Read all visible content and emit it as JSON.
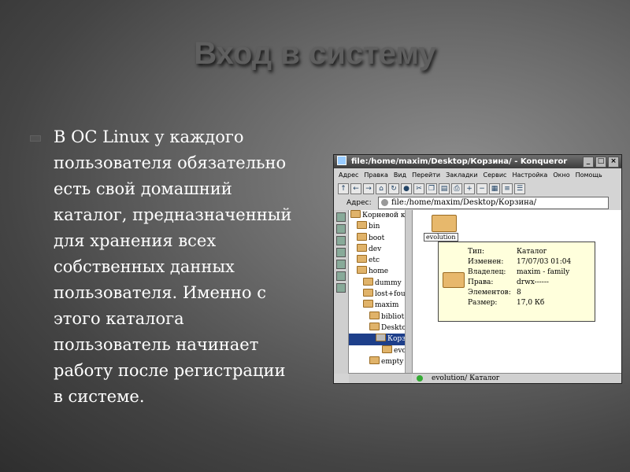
{
  "slide": {
    "title": "Вход в систему",
    "body": "В ОС Linux у каждого\nпользователя обязательно\nесть свой домашний\nкаталог, предназначенный\nдля хранения всех\nсобственных данных\nпользователя. Именно с\nэтого каталога\nпользователь начинает\nработу после регистрации\nв системе."
  },
  "window": {
    "title": "file:/home/maxim/Desktop/Корзина/ - Konqueror",
    "menu": [
      "Адрес",
      "Правка",
      "Вид",
      "Перейти",
      "Закладки",
      "Сервис",
      "Настройка",
      "Окно",
      "Помощь"
    ],
    "address_label": "Адрес:",
    "address": "file:/home/maxim/Desktop/Корзина/",
    "tree": [
      {
        "label": "Корневой каталог",
        "indent": 0
      },
      {
        "label": "bin",
        "indent": 1
      },
      {
        "label": "boot",
        "indent": 1
      },
      {
        "label": "dev",
        "indent": 1
      },
      {
        "label": "etc",
        "indent": 1
      },
      {
        "label": "home",
        "indent": 1
      },
      {
        "label": "dummy",
        "indent": 2
      },
      {
        "label": "lost+found",
        "indent": 2
      },
      {
        "label": "maxim",
        "indent": 2
      },
      {
        "label": "bibliot",
        "indent": 3
      },
      {
        "label": "Deskto",
        "indent": 3
      },
      {
        "label": "Корзина",
        "indent": 4
      },
      {
        "label": "evolution",
        "indent": 5
      },
      {
        "label": "empty",
        "indent": 3
      }
    ],
    "folder_label": "evolution",
    "tooltip": [
      {
        "key": "Тип:",
        "value": "Каталог"
      },
      {
        "key": "Изменен:",
        "value": "17/07/03 01:04"
      },
      {
        "key": "Владелец:",
        "value": "maxim - family"
      },
      {
        "key": "Права:",
        "value": "drwx------"
      },
      {
        "key": "Элементов:",
        "value": "8"
      },
      {
        "key": "Размер:",
        "value": "17,0 Кб"
      }
    ],
    "status": "evolution/  Каталог"
  }
}
